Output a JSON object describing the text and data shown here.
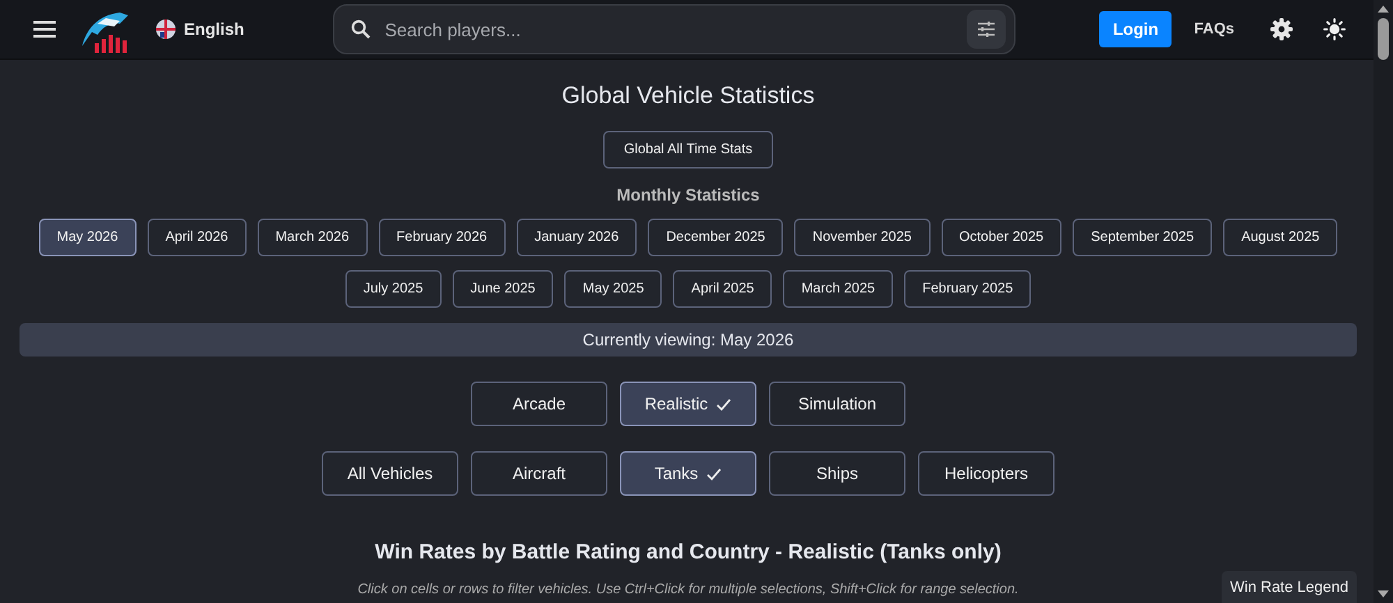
{
  "header": {
    "language": "English",
    "search": {
      "placeholder": "Search players..."
    },
    "login": "Login",
    "faqs": "FAQs"
  },
  "page_title": "Global Vehicle Statistics",
  "all_time_button": "Global All Time Stats",
  "monthly_heading": "Monthly Statistics",
  "months": [
    {
      "label": "May 2026",
      "selected": true
    },
    {
      "label": "April 2026",
      "selected": false
    },
    {
      "label": "March 2026",
      "selected": false
    },
    {
      "label": "February 2026",
      "selected": false
    },
    {
      "label": "January 2026",
      "selected": false
    },
    {
      "label": "December 2025",
      "selected": false
    },
    {
      "label": "November 2025",
      "selected": false
    },
    {
      "label": "October 2025",
      "selected": false
    },
    {
      "label": "September 2025",
      "selected": false
    },
    {
      "label": "August 2025",
      "selected": false
    },
    {
      "label": "July 2025",
      "selected": false
    },
    {
      "label": "June 2025",
      "selected": false
    },
    {
      "label": "May 2025",
      "selected": false
    },
    {
      "label": "April 2025",
      "selected": false
    },
    {
      "label": "March 2025",
      "selected": false
    },
    {
      "label": "February 2025",
      "selected": false
    }
  ],
  "viewing": "Currently viewing: May 2026",
  "modes": [
    {
      "label": "Arcade",
      "selected": false
    },
    {
      "label": "Realistic",
      "selected": true
    },
    {
      "label": "Simulation",
      "selected": false
    }
  ],
  "vehicle_types": [
    {
      "label": "All Vehicles",
      "selected": false
    },
    {
      "label": "Aircraft",
      "selected": false
    },
    {
      "label": "Tanks",
      "selected": true
    },
    {
      "label": "Ships",
      "selected": false
    },
    {
      "label": "Helicopters",
      "selected": false
    }
  ],
  "section_title": "Win Rates by Battle Rating and Country - Realistic (Tanks only)",
  "instructions": "Click on cells or rows to filter vehicles. Use Ctrl+Click for multiple selections, Shift+Click for range selection.",
  "legend_button": "Win Rate Legend"
}
